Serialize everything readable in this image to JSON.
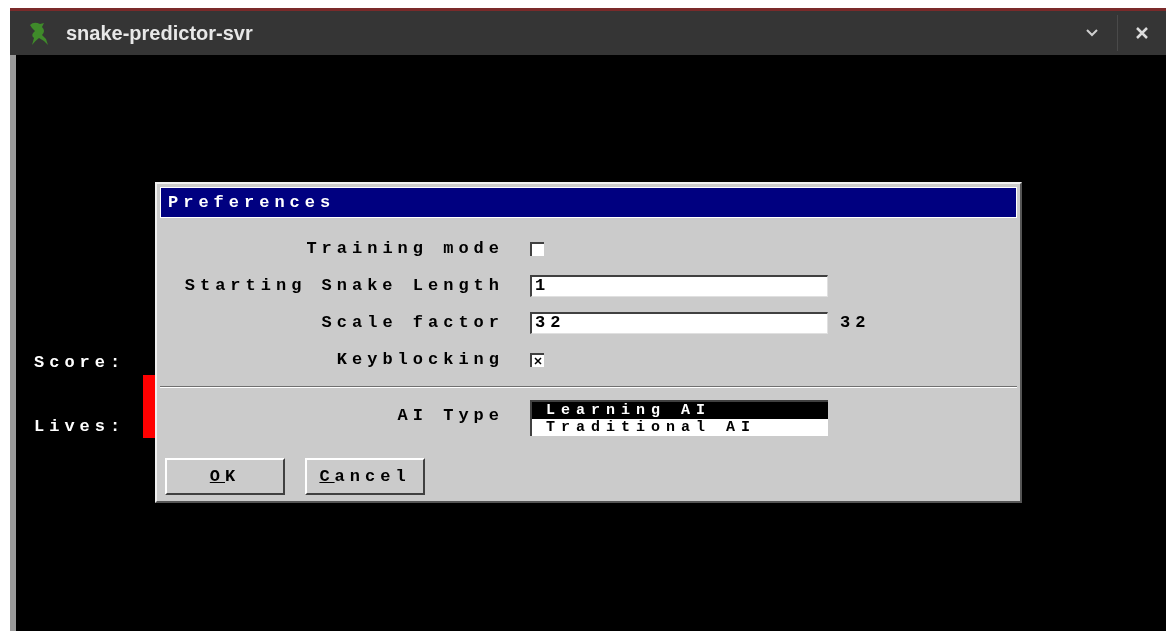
{
  "window": {
    "title": "snake-predictor-svr"
  },
  "game": {
    "score_label": "Score:",
    "lives_label": "Lives:"
  },
  "dialog": {
    "title": "Preferences",
    "rows": [
      {
        "kind": "checkbox",
        "label": "Training mode",
        "checked": false
      },
      {
        "kind": "text",
        "label": "Starting Snake Length",
        "value": "1"
      },
      {
        "kind": "text",
        "label": "Scale factor",
        "value": "32",
        "reading": "32"
      },
      {
        "kind": "checkbox",
        "label": "Keyblocking",
        "checked": true
      }
    ],
    "ai_type": {
      "label": "AI Type",
      "options": [
        {
          "label": "Learning AI",
          "selected": true
        },
        {
          "label": "Traditional AI",
          "selected": false
        }
      ]
    },
    "buttons": [
      {
        "label": "OK"
      },
      {
        "label": "Cancel"
      }
    ]
  }
}
